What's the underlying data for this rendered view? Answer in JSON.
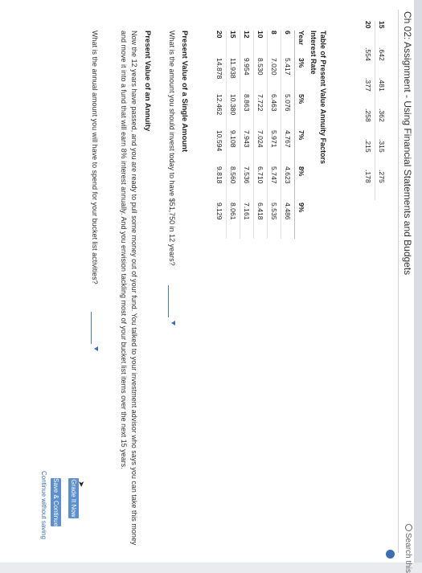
{
  "header": {
    "title": "Ch 02: Assignment - Using Financial Statements and Budgets",
    "search_label": "Search this"
  },
  "top_table": {
    "rows": [
      {
        "year": "15",
        "values": [
          ".642",
          ".481",
          ".362",
          ".315",
          ".275"
        ]
      },
      {
        "year": "20",
        "values": [
          ".554",
          ".377",
          ".258",
          ".215",
          ".178"
        ]
      }
    ]
  },
  "pva_table": {
    "title": "Table of Present Value Annuity Factors",
    "subtitle": "Interest Rate",
    "headers": [
      "Year",
      "3%",
      "5%",
      "7%",
      "8%",
      "9%"
    ],
    "rows": [
      {
        "year": "6",
        "values": [
          "5.417",
          "5.076",
          "4.767",
          "4.623",
          "4.486"
        ]
      },
      {
        "year": "8",
        "values": [
          "7.020",
          "6.463",
          "5.971",
          "5.747",
          "5.535"
        ]
      },
      {
        "year": "10",
        "values": [
          "8.530",
          "7.722",
          "7.024",
          "6.710",
          "6.418"
        ]
      },
      {
        "year": "12",
        "values": [
          "9.954",
          "8.863",
          "7.943",
          "7.536",
          "7.161"
        ]
      },
      {
        "year": "15",
        "values": [
          "11.938",
          "10.380",
          "9.108",
          "8.560",
          "8.061"
        ]
      },
      {
        "year": "20",
        "values": [
          "14.878",
          "12.462",
          "10.594",
          "9.818",
          "9.129"
        ]
      }
    ]
  },
  "single_amount": {
    "title": "Present Value of a Single Amount",
    "question": "What is the amount you should invest today to have $51,750 in 12 years?",
    "answer_value": ""
  },
  "annuity": {
    "title": "Present Value of an Annuity",
    "paragraph": "Now the 12 years have passed, and you are ready to pull some money out of your fund. You talked to your investment advisor who says you can take this money and move it into a fund that will earn 8% interest annually. And you envision tackling most of your bucket list items over the next 15 years.",
    "question": "What is the annual amount you will have to spend for your bucket list activities?",
    "answer_value": ""
  },
  "actions": {
    "grade_label": "Grade It Now",
    "save_label": "Save & Continue",
    "continue_label": "Continue without saving"
  },
  "colors": {
    "accent": "#3d6db3",
    "button": "#5b8fd0"
  }
}
